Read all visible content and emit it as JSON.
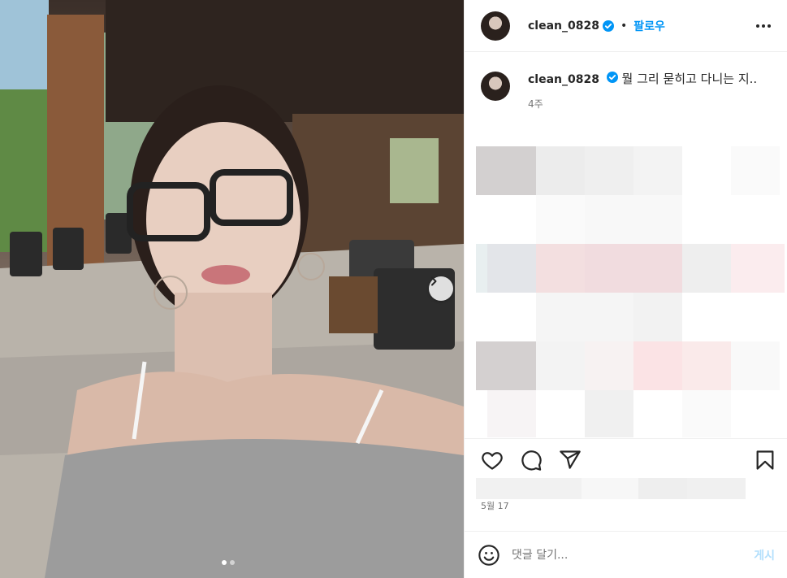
{
  "post": {
    "username": "clean_0828",
    "verified": true,
    "follow_label": "팔로우",
    "separator": "•",
    "caption": "뭘 그리 묻히고 다니는 지..",
    "caption_age": "4주",
    "date": "5월 17",
    "media": {
      "current_slide": 1,
      "total_slides": 2
    }
  },
  "comment": {
    "placeholder": "댓글 달기...",
    "post_label": "게시"
  },
  "icons": {
    "verified": "verified-badge-icon",
    "more": "more-options-icon",
    "like": "heart-icon",
    "comment": "comment-icon",
    "share": "send-icon",
    "save": "bookmark-icon",
    "emoji": "emoji-icon",
    "next": "chevron-right-icon"
  },
  "colors": {
    "accent": "#0095f6",
    "verified": "#0095f6",
    "muted_text": "#737373",
    "post_disabled": "#b2dffc"
  }
}
